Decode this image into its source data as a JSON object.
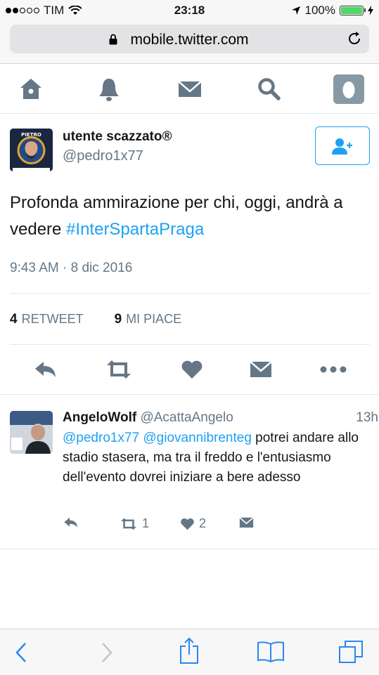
{
  "status_bar": {
    "carrier": "TIM",
    "time": "23:18",
    "battery": "100%",
    "battery_level": 1.0
  },
  "browser": {
    "url": "mobile.twitter.com"
  },
  "nav": {
    "icons": [
      "home-icon",
      "notifications-icon",
      "messages-icon",
      "search-icon",
      "profile-icon"
    ]
  },
  "tweet": {
    "display_name": "utente scazzato®",
    "handle": "@pedro1x77",
    "avatar_text": "PIETRO",
    "text_part1": "Profonda ammirazione per chi, oggi, andrà a vedere ",
    "hashtag": "#InterSpartaPraga",
    "timestamp": "9:43 AM · 8 dic 2016",
    "retweets_count": "4",
    "retweets_label": "RETWEET",
    "likes_count": "9",
    "likes_label": "MI PIACE"
  },
  "reply": {
    "display_name": "AngeloWolf",
    "handle": "@AcattaAngelo",
    "time": "13h",
    "mention1": "@pedro1x77",
    "mention2": "@giovannibrenteg",
    "text": " potrei andare allo stadio stasera, ma tra il freddo e l'entusiasmo dell'evento dovrei iniziare a bere adesso",
    "retweets": "1",
    "likes": "2"
  },
  "colors": {
    "accent": "#1da1f2",
    "icon_gray": "#657786",
    "safari_blue": "#2a86f3"
  }
}
